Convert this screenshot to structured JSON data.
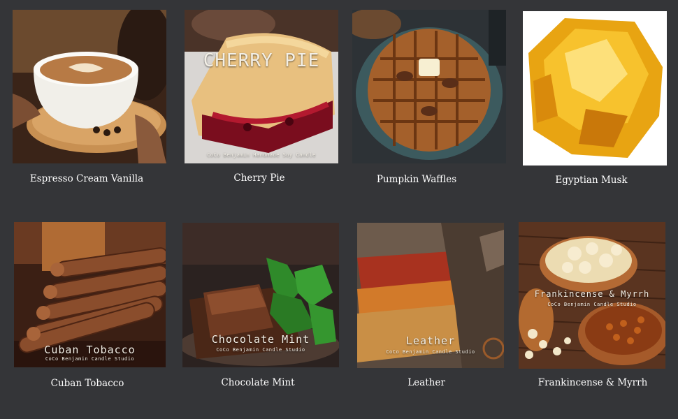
{
  "products": [
    {
      "caption": "Espresso Cream Vanilla",
      "image_overlay": "",
      "image_subtitle": ""
    },
    {
      "caption": "Cherry Pie",
      "image_overlay": "CHERRY PIE",
      "image_subtitle": "CoCo Benjamin Handmade Soy Candle"
    },
    {
      "caption": "Pumpkin  Waffles",
      "image_overlay": "",
      "image_subtitle": ""
    },
    {
      "caption": "Egyptian Musk",
      "image_overlay": "",
      "image_subtitle": ""
    },
    {
      "caption": "Cuban Tobacco",
      "image_overlay": "Cuban Tobacco",
      "image_subtitle": "CoCo Benjamin Candle Studio"
    },
    {
      "caption": "Chocolate Mint",
      "image_overlay": "Chocolate Mint",
      "image_subtitle": "CoCo Benjamin Candle Studio"
    },
    {
      "caption": "Leather",
      "image_overlay": "Leather",
      "image_subtitle": "CoCo Benjamin Candle Studio"
    },
    {
      "caption": "Frankincense & Myrrh",
      "image_overlay": "Frankincense & Myrrh",
      "image_subtitle": "CoCo Benjamin Candle Studio"
    }
  ],
  "colors": {
    "background": "#343538",
    "caption_text": "#ffffff"
  }
}
